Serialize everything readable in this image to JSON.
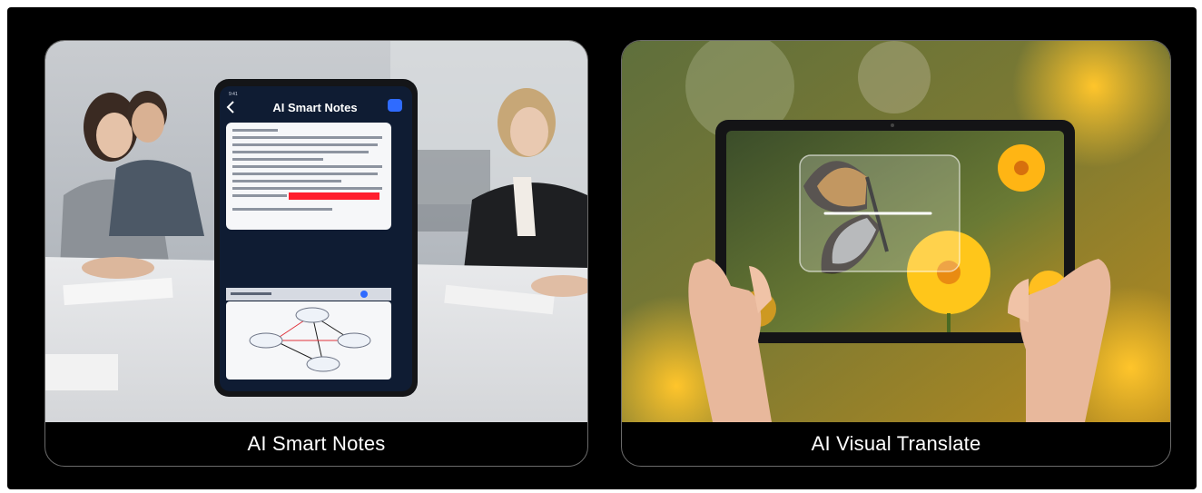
{
  "cards": [
    {
      "caption": "AI Smart Notes",
      "screen_title": "AI Smart Notes"
    },
    {
      "caption": "AI Visual Translate"
    }
  ],
  "colors": {
    "background": "#000000",
    "card_border": "#6b6b6b",
    "caption_text": "#ffffff",
    "highlight_red": "#ff1e2d",
    "accent_blue": "#2f6bff",
    "waveform_cyan": "#21b8ff",
    "flower_yellow": "#ffc61a"
  },
  "icons": [
    "back-chevron-icon",
    "menu-button-icon",
    "mind-map-icon",
    "waveform-icon",
    "scan-frame-icon"
  ]
}
